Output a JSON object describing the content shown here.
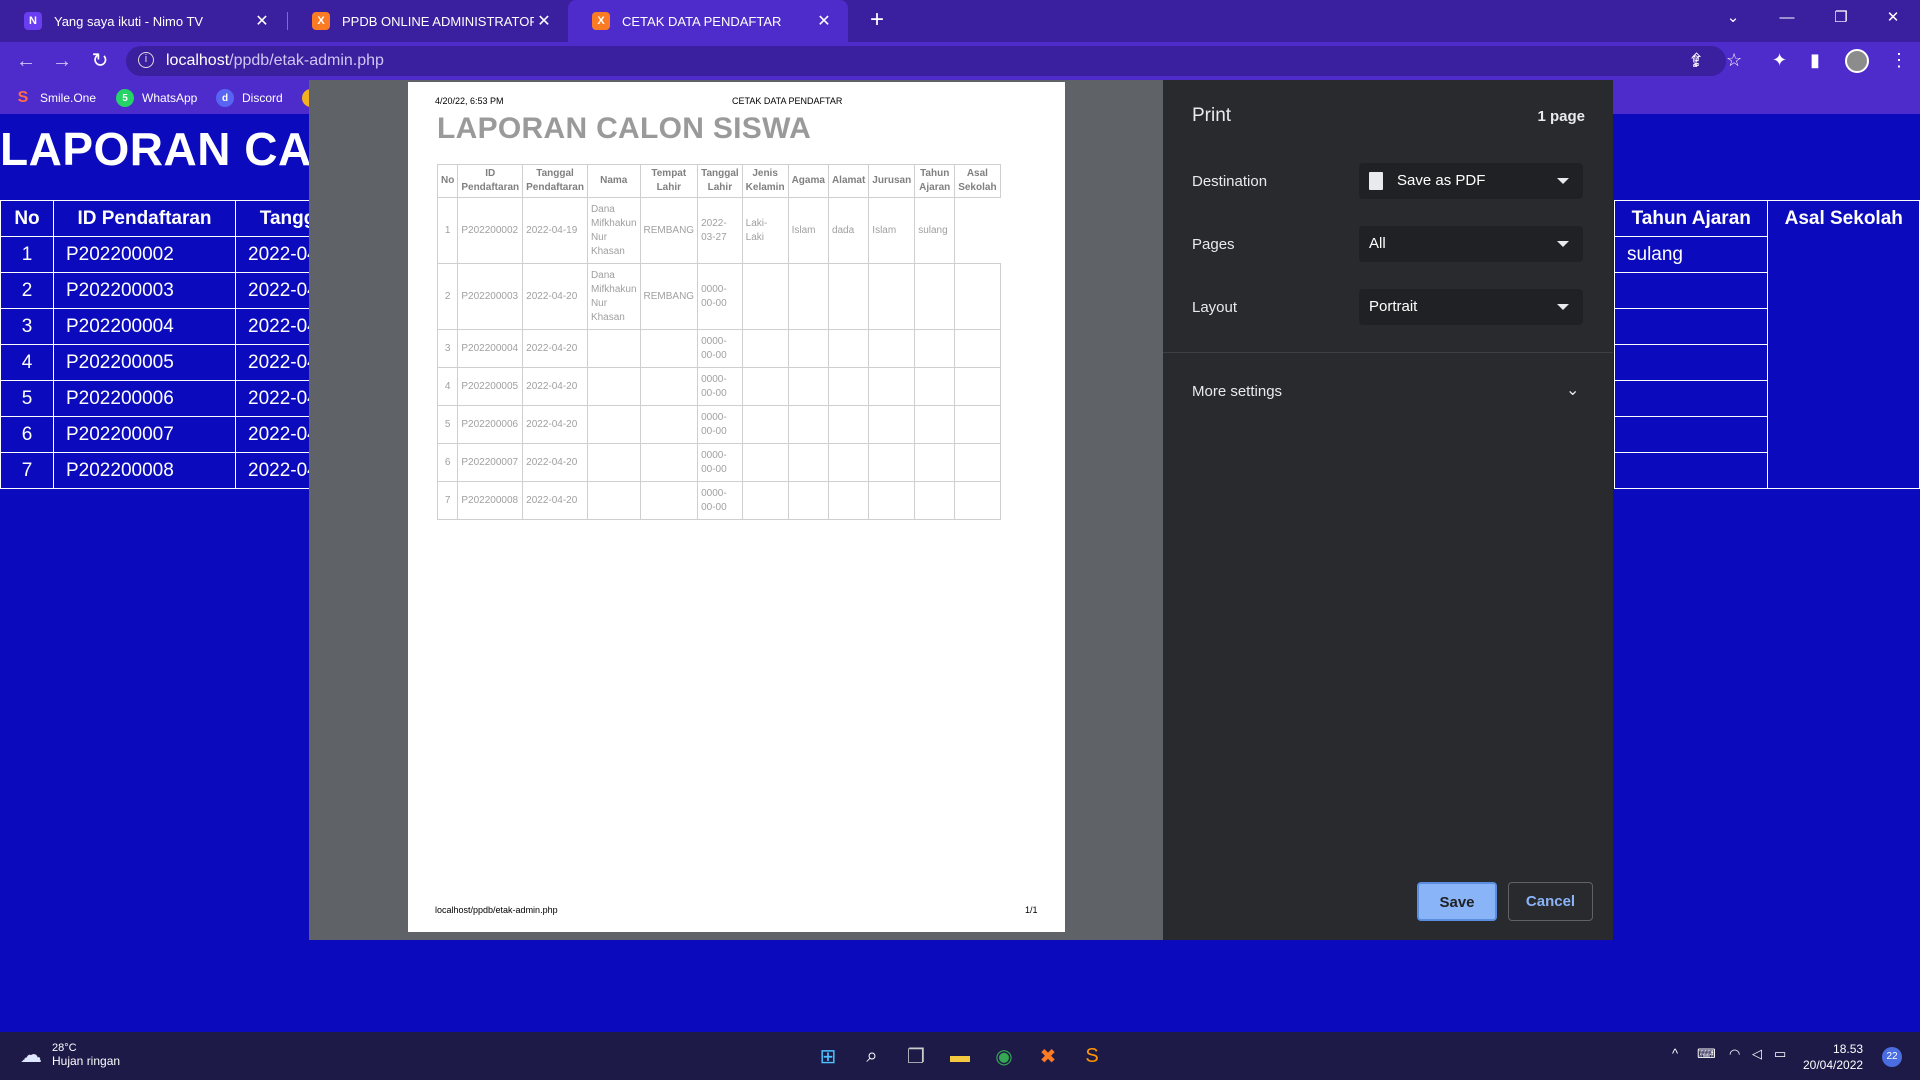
{
  "tabs": [
    {
      "title": "Yang saya ikuti - Nimo TV",
      "icon": "nimo-icon"
    },
    {
      "title": "PPDB ONLINE ADMINISTRATOR",
      "icon": "xampp-icon"
    },
    {
      "title": "CETAK DATA PENDAFTAR",
      "icon": "xampp-icon"
    }
  ],
  "address": {
    "host": "localhost",
    "path": "/ppdb/etak-admin.php"
  },
  "bookmarks": [
    {
      "label": "Smile.One"
    },
    {
      "label": "WhatsApp"
    },
    {
      "label": "Discord"
    }
  ],
  "page": {
    "title": "LAPORAN CALON SISWA",
    "columns": [
      "No",
      "ID Pendaftaran",
      "Tanggal",
      "Tahun Ajaran",
      "Asal Sekolah"
    ],
    "rows": [
      {
        "no": "1",
        "id": "P202200002",
        "tanggal": "2022-04-",
        "tahun": "sulang"
      },
      {
        "no": "2",
        "id": "P202200003",
        "tanggal": "2022-04-",
        "tahun": ""
      },
      {
        "no": "3",
        "id": "P202200004",
        "tanggal": "2022-04-",
        "tahun": ""
      },
      {
        "no": "4",
        "id": "P202200005",
        "tanggal": "2022-04-",
        "tahun": ""
      },
      {
        "no": "5",
        "id": "P202200006",
        "tanggal": "2022-04-",
        "tahun": ""
      },
      {
        "no": "6",
        "id": "P202200007",
        "tanggal": "2022-04-",
        "tahun": ""
      },
      {
        "no": "7",
        "id": "P202200008",
        "tanggal": "2022-04-",
        "tahun": ""
      }
    ]
  },
  "preview": {
    "date": "4/20/22, 6:53 PM",
    "doc_title": "CETAK DATA PENDAFTAR",
    "title": "LAPORAN CALON SISWA",
    "footer_url": "localhost/ppdb/etak-admin.php",
    "footer_page": "1/1",
    "headers": [
      "No",
      "ID Pendaftaran",
      "Tanggal Pendaftaran",
      "Nama",
      "Tempat Lahir",
      "Tanggal Lahir",
      "Jenis Kelamin",
      "Agama",
      "Alamat",
      "Jurusan",
      "Tahun Ajaran",
      "Asal Sekolah"
    ],
    "rows": [
      [
        "1",
        "P202200002",
        "2022-04-19",
        "Dana Mifkhakun Nur Khasan",
        "REMBANG",
        "2022-03-27",
        "Laki-Laki",
        "Islam",
        "dada",
        "Islam",
        "sulang",
        ""
      ],
      [
        "2",
        "P202200003",
        "2022-04-20",
        "Dana Mifkhakun Nur Khasan",
        "REMBANG",
        "0000-00-00",
        "",
        "",
        "",
        "",
        "",
        ""
      ],
      [
        "3",
        "P202200004",
        "2022-04-20",
        "",
        "",
        "0000-00-00",
        "",
        "",
        "",
        "",
        "",
        ""
      ],
      [
        "4",
        "P202200005",
        "2022-04-20",
        "",
        "",
        "0000-00-00",
        "",
        "",
        "",
        "",
        "",
        ""
      ],
      [
        "5",
        "P202200006",
        "2022-04-20",
        "",
        "",
        "0000-00-00",
        "",
        "",
        "",
        "",
        "",
        ""
      ],
      [
        "6",
        "P202200007",
        "2022-04-20",
        "",
        "",
        "0000-00-00",
        "",
        "",
        "",
        "",
        "",
        ""
      ],
      [
        "7",
        "P202200008",
        "2022-04-20",
        "",
        "",
        "0000-00-00",
        "",
        "",
        "",
        "",
        "",
        ""
      ]
    ]
  },
  "print": {
    "title": "Print",
    "page_count": "1 page",
    "destination_label": "Destination",
    "destination_value": "Save as PDF",
    "pages_label": "Pages",
    "pages_value": "All",
    "layout_label": "Layout",
    "layout_value": "Portrait",
    "more_settings": "More settings",
    "save": "Save",
    "cancel": "Cancel"
  },
  "taskbar": {
    "temperature": "28°C",
    "weather": "Hujan ringan",
    "time": "18.53",
    "date": "20/04/2022",
    "notifications": "22"
  }
}
